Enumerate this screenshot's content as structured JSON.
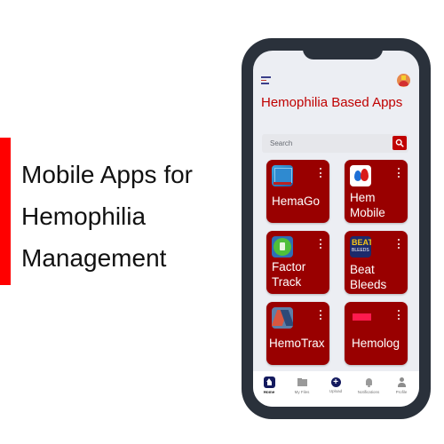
{
  "headline": {
    "lines": [
      "Mobile Apps for",
      "Hemophilia",
      "Management"
    ]
  },
  "app": {
    "title": "Hemophilia Based Apps",
    "search": {
      "placeholder": "Search",
      "value": ""
    },
    "apps": [
      {
        "name": "HemaGo",
        "icon": "hemago-app-icon"
      },
      {
        "name": "Hem Mobile",
        "icon": "hem-mobile-app-icon"
      },
      {
        "name": "Factor Track",
        "icon": "factor-track-app-icon"
      },
      {
        "name": "Beat Bleeds",
        "icon": "beat-bleeds-app-icon",
        "icon_text": [
          "BEAT",
          "BLEEDS"
        ]
      },
      {
        "name": "HemoTrax",
        "icon": "hemotrax-app-icon"
      },
      {
        "name": "Hemolog",
        "icon": "hemolog-app-icon"
      }
    ],
    "bottom_nav": [
      {
        "label": "Home",
        "icon": "home-icon",
        "active": true
      },
      {
        "label": "My Files",
        "icon": "folder-icon",
        "active": false
      },
      {
        "label": "Upload",
        "icon": "upload-plus-icon",
        "active": false
      },
      {
        "label": "Notifications",
        "icon": "bell-icon",
        "active": false
      },
      {
        "label": "Profile",
        "icon": "profile-icon",
        "active": false
      }
    ]
  },
  "colors": {
    "accent_red": "#ff0000",
    "card_red": "#990000",
    "title_red": "#c00000",
    "phone_frame": "#2a313b",
    "nav_active": "#141a5e"
  }
}
